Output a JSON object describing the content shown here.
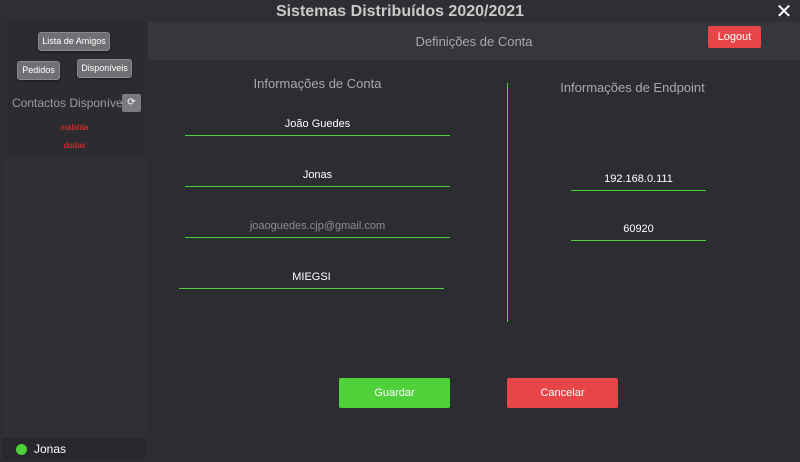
{
  "window": {
    "title": "Sistemas Distribuídos 2020/2021",
    "close_glyph": "✕"
  },
  "sidebar": {
    "friends_button": "Lista de Amigos",
    "requests_button": "Pedidos",
    "available_button": "Disponíveis",
    "contacts_label": "Contactos Disponíveis",
    "refresh_glyph": "⟳",
    "contacts": [
      "mabilda",
      "dudas"
    ],
    "status": {
      "user": "Jonas",
      "color": "#4fd13a"
    }
  },
  "header": {
    "title": "Definições de Conta",
    "logout_label": "Logout"
  },
  "account": {
    "title": "Informações de Conta",
    "name": "João Guedes",
    "username": "Jonas",
    "email": "joaoguedes.cjp@gmail.com",
    "course": "MIEGSI"
  },
  "endpoint": {
    "title": "Informações de Endpoint",
    "ip": "192.168.0.111",
    "port": "60920"
  },
  "actions": {
    "save_label": "Guardar",
    "cancel_label": "Cancelar"
  },
  "colors": {
    "accent_green": "#4fd13a",
    "danger_red": "#e74548",
    "background": "#2b2d33"
  }
}
